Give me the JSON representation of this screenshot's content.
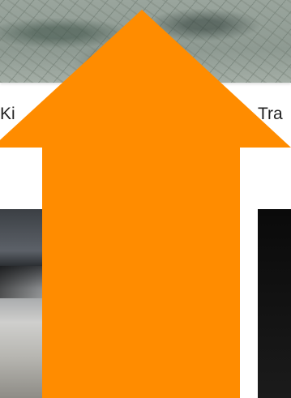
{
  "cards": {
    "left": {
      "label": "Ki"
    },
    "right": {
      "label": "Tra"
    }
  },
  "overlay": {
    "icon": "up-arrow-icon",
    "color": "#ff8c00"
  }
}
